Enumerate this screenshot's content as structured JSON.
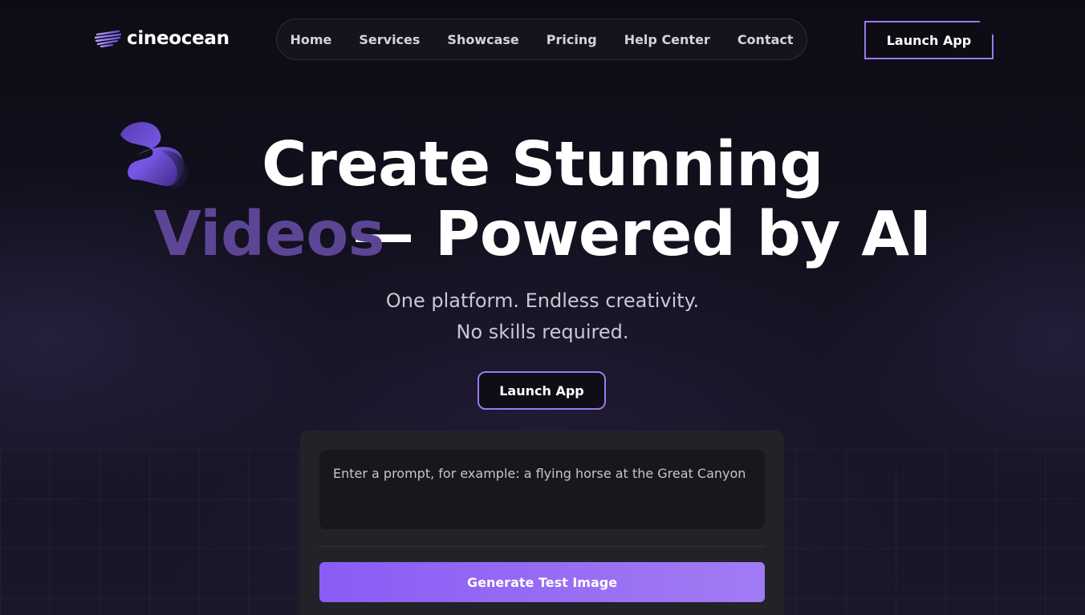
{
  "brand": {
    "name": "cineocean",
    "accent": "#9b7af0"
  },
  "nav": {
    "items": [
      {
        "label": "Home"
      },
      {
        "label": "Services"
      },
      {
        "label": "Showcase"
      },
      {
        "label": "Pricing"
      },
      {
        "label": "Help Center"
      },
      {
        "label": "Contact"
      }
    ]
  },
  "header": {
    "launch_label": "Launch App"
  },
  "hero": {
    "line1": "Create Stunning",
    "videos": "Videos",
    "dash": "—",
    "powered": " Powered by AI",
    "sub1": "One platform. Endless creativity.",
    "sub2": "No skills required.",
    "launch_label": "Launch App"
  },
  "prompt_card": {
    "placeholder": "Enter a prompt, for example: a flying horse at the Great Canyon",
    "button_label": "Generate Test Image",
    "button_color_start": "#8a5cf5",
    "button_color_end": "#a17bf4"
  }
}
